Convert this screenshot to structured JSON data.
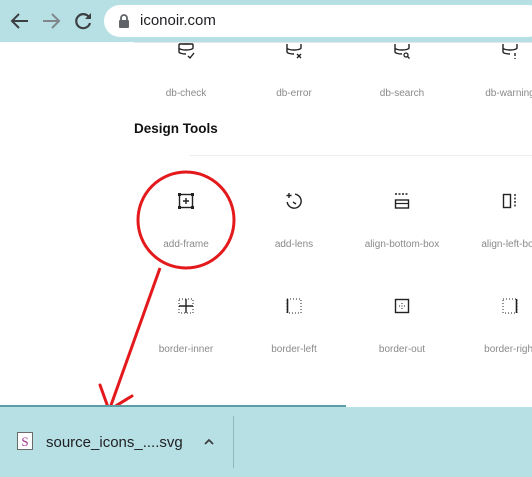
{
  "browser": {
    "url": "iconoir.com",
    "icons": {
      "back": "arrow-left-icon",
      "forward": "arrow-right-icon",
      "reload": "reload-icon",
      "lock": "lock-icon"
    }
  },
  "db_row": [
    {
      "label": "db-check",
      "icon": "db-check-icon"
    },
    {
      "label": "db-error",
      "icon": "db-error-icon"
    },
    {
      "label": "db-search",
      "icon": "db-search-icon"
    },
    {
      "label": "db-warning",
      "icon": "db-warning-icon"
    }
  ],
  "section": {
    "title": "Design Tools"
  },
  "design_row1": [
    {
      "label": "add-frame",
      "icon": "add-frame-icon"
    },
    {
      "label": "add-lens",
      "icon": "add-lens-icon"
    },
    {
      "label": "align-bottom-box",
      "icon": "align-bottom-box-icon"
    },
    {
      "label": "align-left-box",
      "icon": "align-left-box-icon"
    }
  ],
  "design_row2": [
    {
      "label": "border-inner",
      "icon": "border-inner-icon"
    },
    {
      "label": "border-left",
      "icon": "border-left-icon"
    },
    {
      "label": "border-out",
      "icon": "border-out-icon"
    },
    {
      "label": "border-right",
      "icon": "border-right-icon"
    }
  ],
  "annotation": {
    "color": "#e3191c"
  },
  "download": {
    "filename": "source_icons_....svg",
    "icons": {
      "file": "svg-file-icon",
      "menu": "chevron-up-icon"
    }
  },
  "colors": {
    "toolbar": "#b7e0e5",
    "label": "#8a8a8a"
  }
}
